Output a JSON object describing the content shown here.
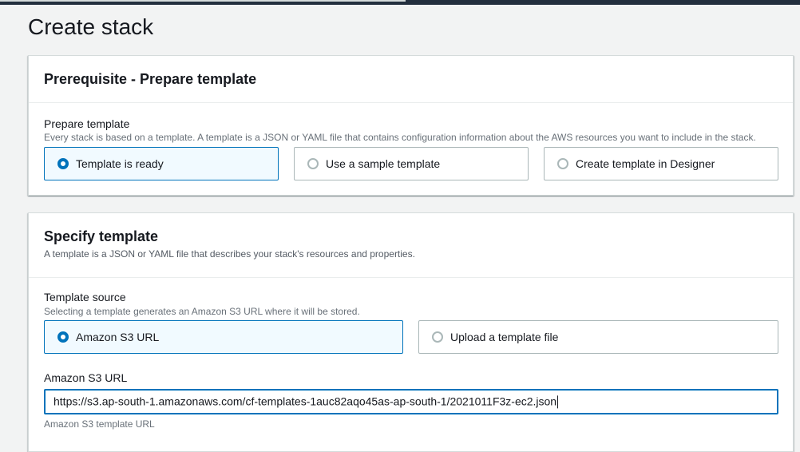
{
  "page": {
    "title": "Create stack"
  },
  "prerequisite": {
    "title": "Prerequisite - Prepare template",
    "field_label": "Prepare template",
    "field_description": "Every stack is based on a template. A template is a JSON or YAML file that contains configuration information about the AWS resources you want to include in the stack.",
    "options": [
      {
        "label": "Template is ready",
        "selected": true
      },
      {
        "label": "Use a sample template",
        "selected": false
      },
      {
        "label": "Create template in Designer",
        "selected": false
      }
    ]
  },
  "specify": {
    "title": "Specify template",
    "description": "A template is a JSON or YAML file that describes your stack's resources and properties.",
    "source_label": "Template source",
    "source_description": "Selecting a template generates an Amazon S3 URL where it will be stored.",
    "source_options": [
      {
        "label": "Amazon S3 URL",
        "selected": true
      },
      {
        "label": "Upload a template file",
        "selected": false
      }
    ],
    "url_label": "Amazon S3 URL",
    "url_value": "https://s3.ap-south-1.amazonaws.com/cf-templates-1auc82aqo45as-ap-south-1/2021011F3z-ec2.json",
    "url_hint": "Amazon S3 template URL"
  },
  "colors": {
    "accent": "#0073bb",
    "selected_bg": "#f1faff",
    "page_bg": "#f2f3f3",
    "topbar": "#232f3e"
  }
}
